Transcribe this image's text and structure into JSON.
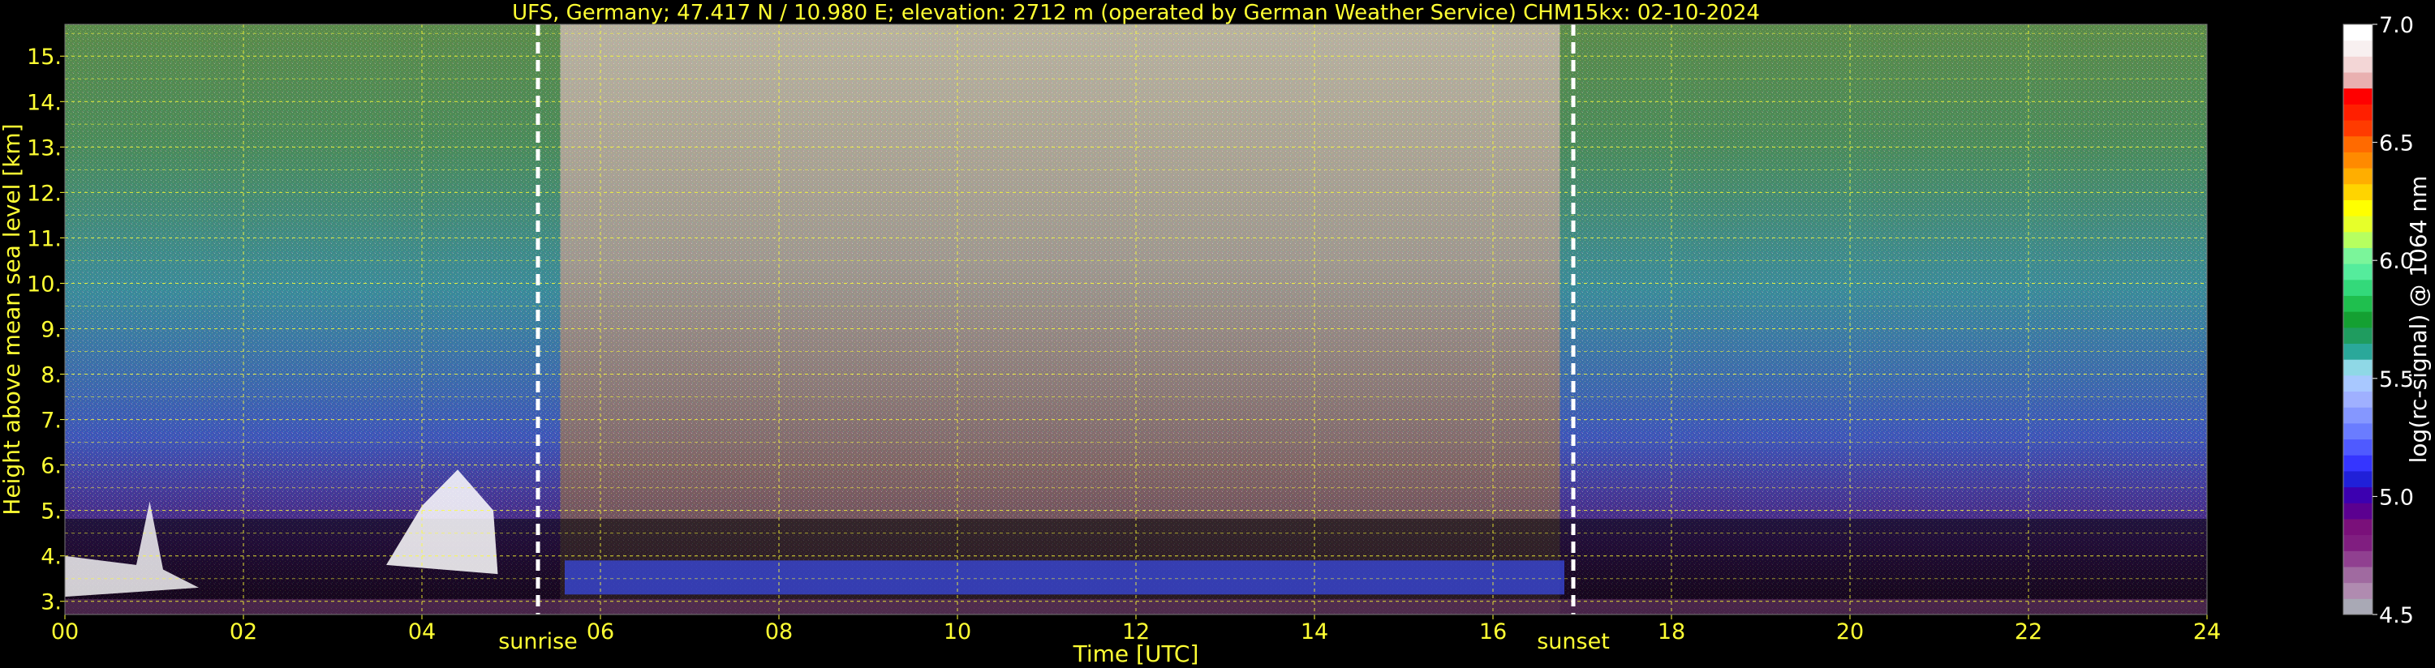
{
  "chart_data": {
    "type": "heatmap",
    "title": "UFS, Germany; 47.417 N / 10.980 E; elevation: 2712 m  (operated by German Weather Service)    CHM15kx: 02-10-2024",
    "xlabel": "Time [UTC]",
    "ylabel": "Height above mean sea level [km]",
    "xlim": [
      0,
      24
    ],
    "ylim": [
      2.71,
      15.7
    ],
    "x_ticks": [
      "00",
      "02",
      "04",
      "06",
      "08",
      "10",
      "12",
      "14",
      "16",
      "18",
      "20",
      "22",
      "24"
    ],
    "y_ticks": [
      "3.",
      "4.",
      "5.",
      "6.",
      "7.",
      "8.",
      "9.",
      "10.",
      "11.",
      "12.",
      "13.",
      "14.",
      "15."
    ],
    "grid": true,
    "colorbar": {
      "label": "log(rc-signal) @ 1064 nm",
      "range": [
        4.5,
        7.0
      ],
      "ticks": [
        "4.5",
        "5.0",
        "5.5",
        "6.0",
        "6.5",
        "7.0"
      ],
      "colors": [
        "#a9a9b5",
        "#b08bb0",
        "#a06aa0",
        "#904090",
        "#801e80",
        "#7a107a",
        "#5b0090",
        "#3c00b0",
        "#2020d8",
        "#3535ff",
        "#4f5aff",
        "#6a7cff",
        "#8597ff",
        "#9fb0ff",
        "#a8c8ff",
        "#8fd8e6",
        "#2aa89a",
        "#1f9c5f",
        "#14a032",
        "#1fbf4e",
        "#33d97a",
        "#55ec9c",
        "#7bf59a",
        "#b6ff60",
        "#e6ff2a",
        "#ffff00",
        "#ffd400",
        "#ffae00",
        "#ff8a00",
        "#ff6a00",
        "#ff3b00",
        "#ff1f00",
        "#ff0000",
        "#e9b0b0",
        "#f3d6d6",
        "#f8f0f0",
        "#ffffff"
      ]
    },
    "events": [
      {
        "label": "sunrise",
        "time": 5.3
      },
      {
        "label": "sunset",
        "time": 16.9
      }
    ]
  }
}
